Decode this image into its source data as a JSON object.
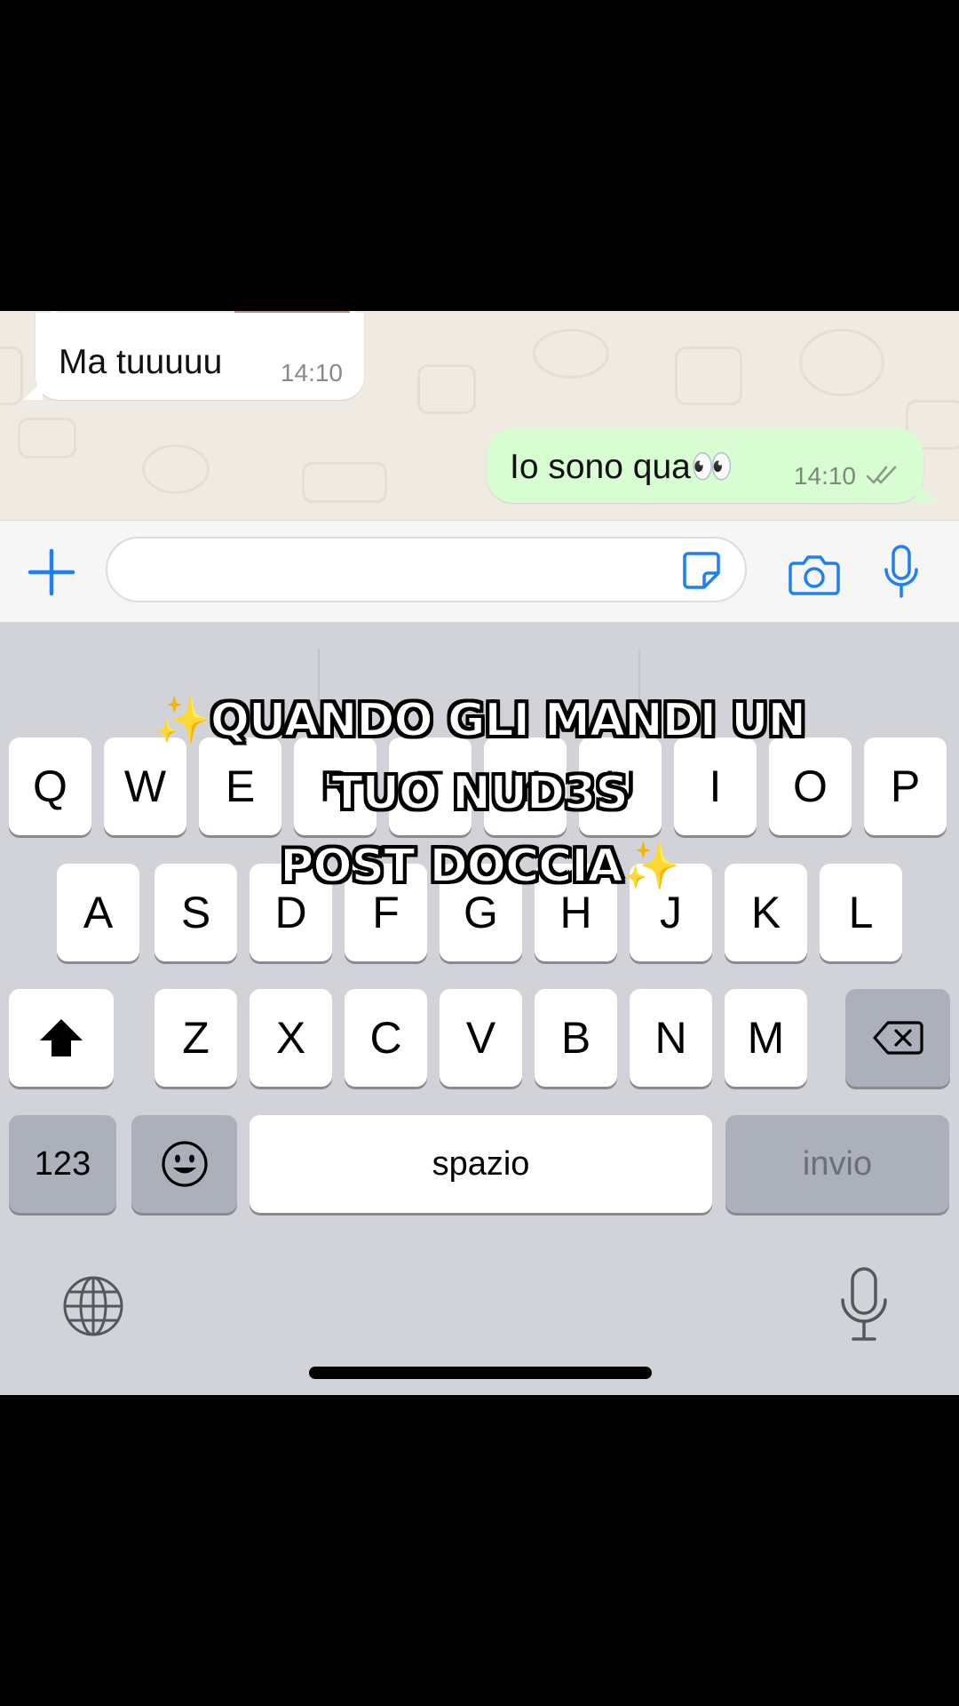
{
  "chat": {
    "incoming": {
      "text": "Ma tuuuuu",
      "time": "14:10"
    },
    "outgoing": {
      "text": "Io sono qua👀",
      "time": "14:10",
      "status_icon": "double-check-icon"
    }
  },
  "composer": {
    "input_value": "",
    "icons": [
      "plus-icon",
      "sticker-icon",
      "camera-icon",
      "microphone-icon"
    ],
    "accent_color": "#1f7ff3"
  },
  "keyboard": {
    "row1": [
      "Q",
      "W",
      "E",
      "R",
      "T",
      "Y",
      "U",
      "I",
      "O",
      "P"
    ],
    "row2": [
      "A",
      "S",
      "D",
      "F",
      "G",
      "H",
      "J",
      "K",
      "L"
    ],
    "row3": [
      "Z",
      "X",
      "C",
      "V",
      "B",
      "N",
      "M"
    ],
    "numbers_key": "123",
    "space_key": "spazio",
    "return_key": "invio",
    "icons": [
      "shift-icon",
      "backspace-icon",
      "emoji-icon",
      "globe-icon",
      "dictation-icon"
    ]
  },
  "caption": {
    "line1": "QUANDO GLI MANDI UN",
    "line2": "TUO NUD3S",
    "line3": "POST DOCCIA",
    "sparkle": "✨"
  }
}
